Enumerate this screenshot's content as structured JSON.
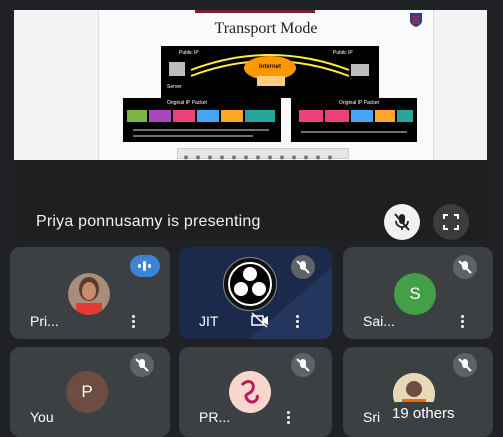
{
  "slide": {
    "title": "Transport Mode",
    "diagram_labels": {
      "public_ip_left": "Public IP",
      "public_ip_right": "Public IP",
      "internet": "Internet",
      "server": "Server",
      "original_ip_packet_1": "Original IP Packet",
      "original_ip_packet_2": "Original IP Packet"
    }
  },
  "presenter": {
    "text": "Priya ponnusamy is presenting",
    "mic_icon": "mic-off-icon",
    "fullscreen_icon": "fullscreen-icon"
  },
  "participants": [
    {
      "name": "Pri...",
      "speaking": true,
      "avatar_type": "photo"
    },
    {
      "name": "JIT",
      "camera_off": true,
      "muted": true,
      "avatar_type": "logo"
    },
    {
      "name": "Sai...",
      "muted": true,
      "avatar_letter": "S",
      "avatar_color": "#43a047"
    },
    {
      "name": "You",
      "muted": true,
      "avatar_letter": "P",
      "avatar_color": "#6d4c41"
    },
    {
      "name": "PR...",
      "muted": true,
      "avatar_type": "photo"
    },
    {
      "name": "Sri",
      "muted": true,
      "avatar_type": "photo"
    }
  ],
  "others_badge": "19 others",
  "colors": {
    "background": "#202124",
    "tile": "#3c4043",
    "speaking": "#3c84d6"
  }
}
